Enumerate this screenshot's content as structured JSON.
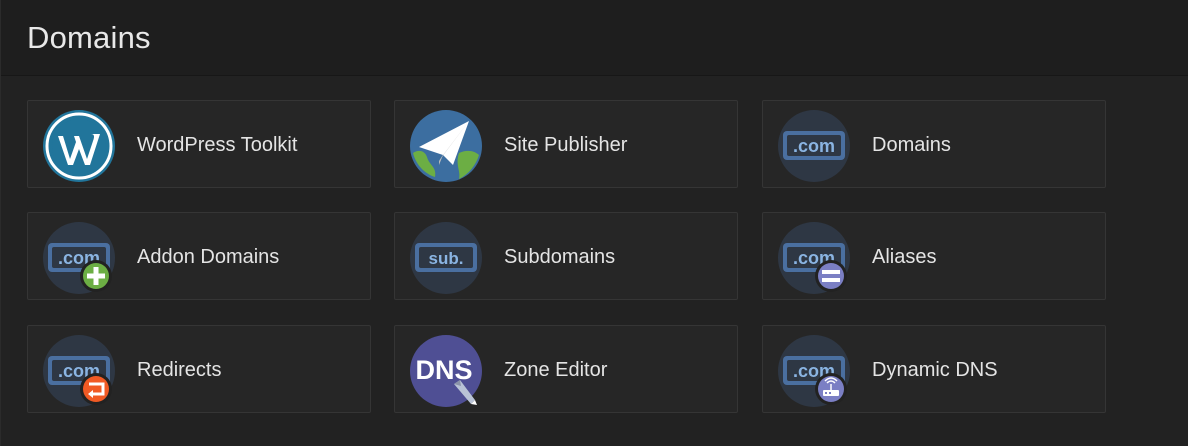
{
  "section": {
    "title": "Domains"
  },
  "tools": [
    {
      "label": "WordPress Toolkit",
      "icon": "wordpress-icon"
    },
    {
      "label": "Site Publisher",
      "icon": "site-publisher-icon"
    },
    {
      "label": "Domains",
      "icon": "domains-icon"
    },
    {
      "label": "Addon Domains",
      "icon": "addon-domains-icon"
    },
    {
      "label": "Subdomains",
      "icon": "subdomains-icon"
    },
    {
      "label": "Aliases",
      "icon": "aliases-icon"
    },
    {
      "label": "Redirects",
      "icon": "redirects-icon"
    },
    {
      "label": "Zone Editor",
      "icon": "zone-editor-icon"
    },
    {
      "label": "Dynamic DNS",
      "icon": "dynamic-dns-icon"
    }
  ],
  "icon_text": {
    "com": ".com",
    "sub": "sub.",
    "dns": "DNS"
  },
  "colors": {
    "icon_circle": "#2e3744",
    "badge_blue": "#4a6fa0",
    "wordpress": "#21759b",
    "add_green": "#6cae44",
    "alias_purple": "#7b7fc4",
    "redirect_orange": "#f15a24",
    "dns_purple": "#4f4f94"
  }
}
